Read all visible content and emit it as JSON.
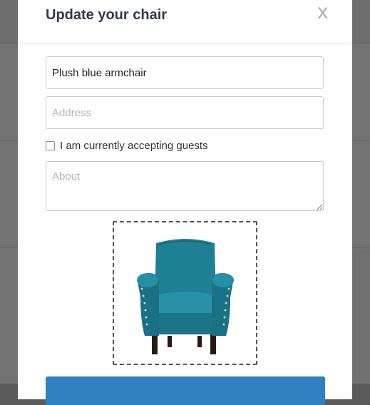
{
  "modal": {
    "title": "Update your chair",
    "close_label": "X",
    "name_value": "Plush blue armchair",
    "address_placeholder": "Address",
    "accepting_guests_label": "I am currently accepting guests",
    "about_placeholder": "About",
    "submit_label": "",
    "image_icon": "armchair-photo"
  },
  "colors": {
    "title": "#2f3b4c",
    "chair": "#1f7f94",
    "submit": "#2f7fc1"
  }
}
